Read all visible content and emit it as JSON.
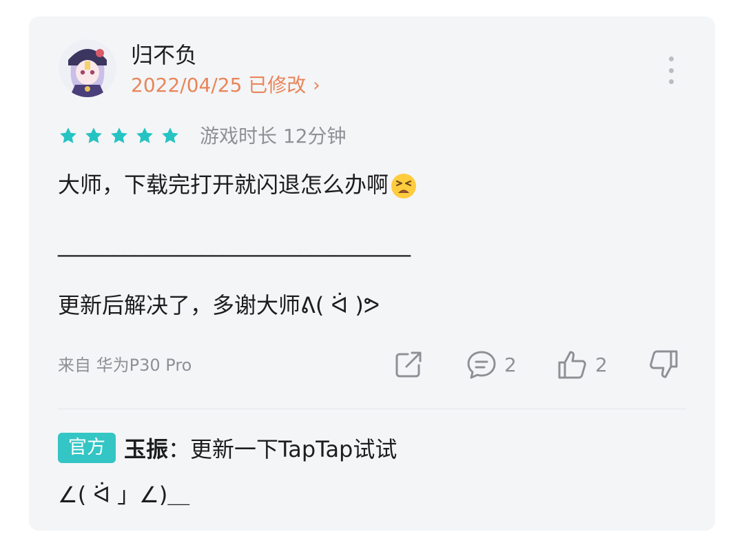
{
  "user": {
    "name": "归不负",
    "date": "2022/04/25 已修改",
    "chevron": "›"
  },
  "rating": {
    "stars": 5,
    "max": 5,
    "color": "#26c3c3",
    "playtime": "游戏时长 12分钟"
  },
  "review": {
    "line1": "大师，下载完打开就闪退怎么办啊",
    "line1_emoji": "tired-face-emoji",
    "line2": "________________________________",
    "line3": "更新后解决了，多谢大师ᕕ( ᐛ )ᕗ"
  },
  "device": "来自 华为P30 Pro",
  "actions": {
    "comment_count": "2",
    "like_count": "2"
  },
  "reply": {
    "badge": "官方",
    "author": "玉振",
    "text": "：更新一下TapTap试试",
    "continuation": "∠( ᐛ 」∠)＿"
  },
  "colors": {
    "accent": "#34c5c5",
    "date": "#e8855a",
    "muted": "#8e9096",
    "card_bg": "#f4f5f7"
  },
  "icons": [
    "avatar",
    "more-vertical-icon",
    "star-icon",
    "tired-face-emoji",
    "share-icon",
    "comment-icon",
    "thumbs-up-icon",
    "thumbs-down-icon"
  ]
}
